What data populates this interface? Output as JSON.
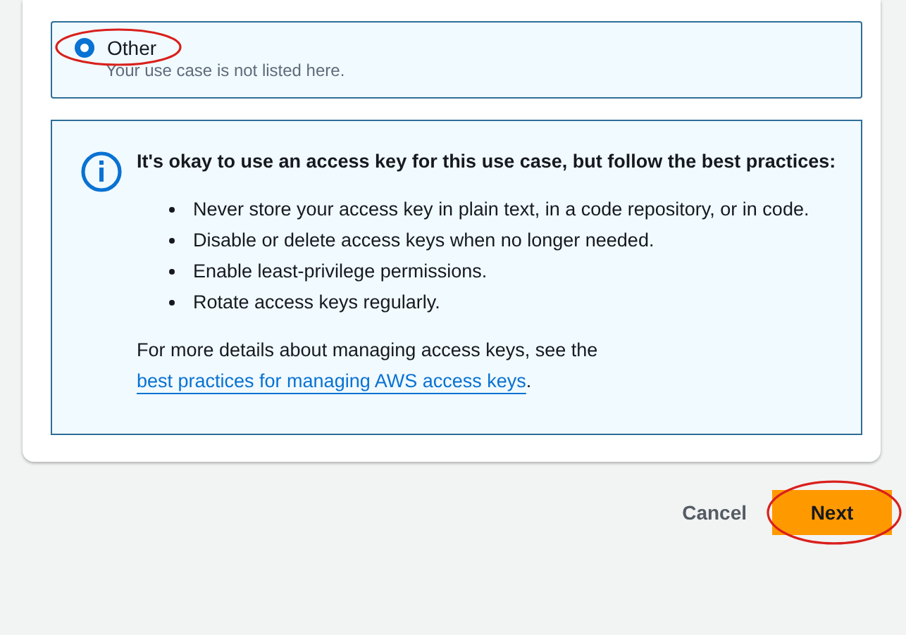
{
  "option": {
    "label": "Other",
    "description": "Your use case is not listed here.",
    "selected": true,
    "annotated": true
  },
  "alert": {
    "heading": "It's okay to use an access key for this use case, but follow the best practices:",
    "bullets": [
      "Never store your access key in plain text, in a code repository, or in code.",
      "Disable or delete access keys when no longer needed.",
      "Enable least-privilege permissions.",
      "Rotate access keys regularly."
    ],
    "footer_text": "For more details about managing access keys, see the",
    "footer_link": "best practices for managing AWS access keys",
    "footer_end": "."
  },
  "buttons": [
    {
      "label": "Cancel",
      "kind": "link",
      "annotated": false
    },
    {
      "label": "Next",
      "kind": "primary",
      "annotated": true
    }
  ]
}
